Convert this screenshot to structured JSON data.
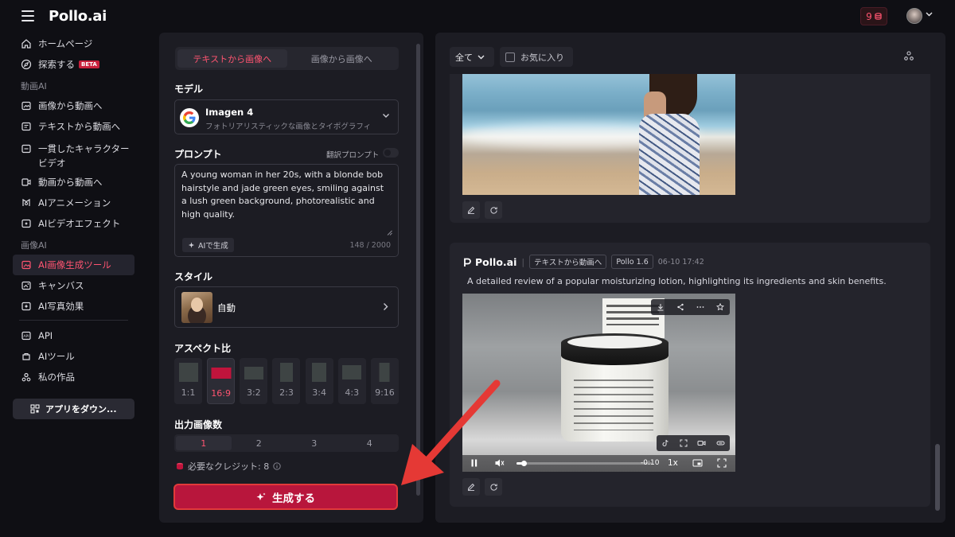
{
  "brand": {
    "name": "Pollo.ai",
    "accent": "#ff5470",
    "primary": "#b8163c"
  },
  "topbar": {
    "credits": "9",
    "credits_icon": "coin-stack-icon",
    "avatar_icon": "avatar-icon"
  },
  "sidebar": {
    "items_top": [
      {
        "label": "ホームページ",
        "icon": "home-icon"
      },
      {
        "label": "探索する",
        "icon": "compass-icon",
        "badge": "BETA"
      }
    ],
    "section_video": "動画AI",
    "items_video": [
      {
        "label": "画像から動画へ",
        "icon": "image-video-icon"
      },
      {
        "label": "テキストから動画へ",
        "icon": "text-video-icon"
      },
      {
        "label": "一貫したキャラクタービデオ",
        "icon": "character-icon"
      },
      {
        "label": "動画から動画へ",
        "icon": "video-video-icon"
      },
      {
        "label": "AIアニメーション",
        "icon": "animation-icon"
      },
      {
        "label": "AIビデオエフェクト",
        "icon": "effect-icon"
      }
    ],
    "section_image": "画像AI",
    "items_image": [
      {
        "label": "AI画像生成ツール",
        "icon": "image-gen-icon",
        "active": true
      },
      {
        "label": "キャンバス",
        "icon": "canvas-icon"
      },
      {
        "label": "AI写真効果",
        "icon": "photo-effect-icon"
      }
    ],
    "items_bottom": [
      {
        "label": "API",
        "icon": "api-icon"
      },
      {
        "label": "AIツール",
        "icon": "tools-icon"
      },
      {
        "label": "私の作品",
        "icon": "works-icon"
      }
    ],
    "download_label": "アプリをダウン..."
  },
  "generator": {
    "tabs": [
      "テキストから画像へ",
      "画像から画像へ"
    ],
    "model_label": "モデル",
    "model_name": "Imagen 4",
    "model_desc": "フォトリアリスティックな画像とタイポグラフィ",
    "prompt_label": "プロンプト",
    "translate_label": "翻訳プロンプト",
    "prompt_text": "A young woman in her 20s, with a blonde bob hairstyle and jade green eyes, smiling against a lush green background, photorealistic and high quality.",
    "ai_generate": "AIで生成",
    "char_count": "148 / 2000",
    "style_label": "スタイル",
    "style_value": "自動",
    "aspect_label": "アスペクト比",
    "aspects": [
      "1:1",
      "16:9",
      "3:2",
      "2:3",
      "3:4",
      "4:3",
      "9:16"
    ],
    "aspect_selected": "16:9",
    "count_label": "出力画像数",
    "counts": [
      "1",
      "2",
      "3",
      "4"
    ],
    "count_selected": "1",
    "credits_needed": "必要なクレジット: 8",
    "generate_label": "生成する"
  },
  "results": {
    "filter_label": "全て",
    "favorites_label": "お気に入り",
    "card2": {
      "brand": "Pollo.ai",
      "mode_tag": "テキストから動画へ",
      "model_tag": "Pollo 1.6",
      "timestamp": "06-10 17:42",
      "description": "A detailed review of a popular moisturizing lotion, highlighting its ingredients and skin benefits.",
      "video_time": "-0:10",
      "video_speed": "1x",
      "video_progress": 0.05
    }
  }
}
